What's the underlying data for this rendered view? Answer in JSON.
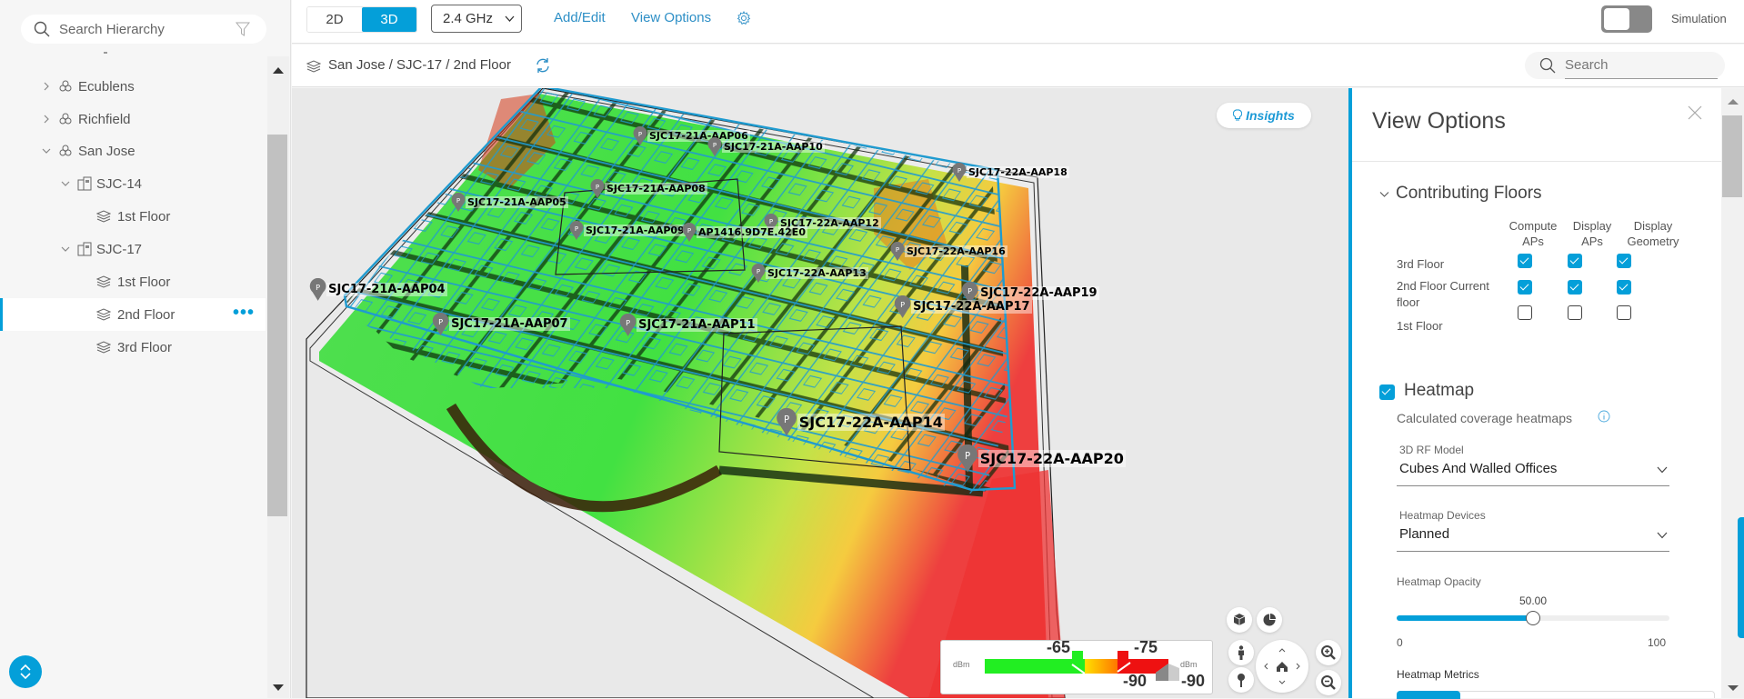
{
  "sidebar": {
    "search_placeholder": "Search Hierarchy",
    "tree": [
      {
        "label": "Ecublens",
        "type": "area",
        "expanded": false,
        "level": 1
      },
      {
        "label": "Richfield",
        "type": "area",
        "expanded": false,
        "level": 1
      },
      {
        "label": "San Jose",
        "type": "area",
        "expanded": true,
        "level": 1
      },
      {
        "label": "SJC-14",
        "type": "building",
        "expanded": true,
        "level": 2
      },
      {
        "label": "1st Floor",
        "type": "floor",
        "level": 3
      },
      {
        "label": "SJC-17",
        "type": "building",
        "expanded": true,
        "level": 2
      },
      {
        "label": "1st Floor",
        "type": "floor",
        "level": 3
      },
      {
        "label": "2nd Floor",
        "type": "floor",
        "level": 3,
        "selected": true
      },
      {
        "label": "3rd Floor",
        "type": "floor",
        "level": 3
      }
    ],
    "more_label": "•••"
  },
  "toolbar": {
    "view_2d": "2D",
    "view_3d": "3D",
    "active_view": "3D",
    "band": "2.4 GHz",
    "add_edit": "Add/Edit",
    "view_options": "View Options",
    "simulation_label": "Simulation",
    "simulation_on": false
  },
  "breadcrumb": {
    "path": "San Jose / SJC-17 / 2nd Floor",
    "search_placeholder": "Search"
  },
  "map": {
    "insights_label": "Insights",
    "access_points": [
      {
        "name": "SJC17-21A-AAP06",
        "size": "small"
      },
      {
        "name": "SJC17-21A-AAP10",
        "size": "small"
      },
      {
        "name": "SJC17-22A-AAP18",
        "size": "small"
      },
      {
        "name": "SJC17-21A-AAP08",
        "size": "small"
      },
      {
        "name": "SJC17-21A-AAP05",
        "size": "small"
      },
      {
        "name": "SJC17-22A-AAP12",
        "size": "small"
      },
      {
        "name": "SJC17-21A-AAP09",
        "size": "small"
      },
      {
        "name": "AP1416.9D7E.42E0",
        "size": "small"
      },
      {
        "name": "SJC17-22A-AAP16",
        "size": "small"
      },
      {
        "name": "SJC17-22A-AAP13",
        "size": "small"
      },
      {
        "name": "SJC17-21A-AAP04",
        "size": "medium"
      },
      {
        "name": "SJC17-22A-AAP19",
        "size": "medium"
      },
      {
        "name": "SJC17-22A-AAP17",
        "size": "medium"
      },
      {
        "name": "SJC17-21A-AAP07",
        "size": "medium"
      },
      {
        "name": "SJC17-21A-AAP11",
        "size": "medium"
      },
      {
        "name": "SJC17-22A-AAP14",
        "size": "large"
      },
      {
        "name": "SJC17-22A-AAP20",
        "size": "large"
      }
    ],
    "legend": {
      "unit_left": "dBm",
      "unit_right": "dBm",
      "threshold_high": "-65",
      "threshold_mid": "-75",
      "floor_min_left": "-90",
      "floor_min_right": "-90",
      "colors": {
        "good": "#22ee22",
        "mid_start": "#ffdd00",
        "mid_end": "#ff8800",
        "bad": "#ee1111"
      }
    }
  },
  "view_options": {
    "title": "View Options",
    "contributing_floors": {
      "title": "Contributing Floors",
      "columns": [
        "Compute\nAPs",
        "Display\nAPs",
        "Display\nGeometry"
      ],
      "rows": [
        {
          "label": "3rd Floor",
          "compute_aps": true,
          "display_aps": true,
          "display_geometry": true
        },
        {
          "label": "2nd Floor Current floor",
          "compute_aps": true,
          "display_aps": true,
          "display_geometry": true
        },
        {
          "label": "1st Floor",
          "compute_aps": false,
          "display_aps": false,
          "display_geometry": false
        }
      ]
    },
    "heatmap": {
      "enabled": true,
      "title": "Heatmap",
      "subtitle": "Calculated coverage heatmaps",
      "rf_model_label": "3D RF Model",
      "rf_model_value": "Cubes And Walled Offices",
      "devices_label": "Heatmap Devices",
      "devices_value": "Planned",
      "opacity_label": "Heatmap Opacity",
      "opacity_value": "50.00",
      "opacity_fraction": 0.5,
      "opacity_min": "0",
      "opacity_max": "100",
      "metrics_label": "Heatmap Metrics"
    }
  },
  "colors": {
    "accent": "#049fd9",
    "link": "#2d8fc6"
  }
}
